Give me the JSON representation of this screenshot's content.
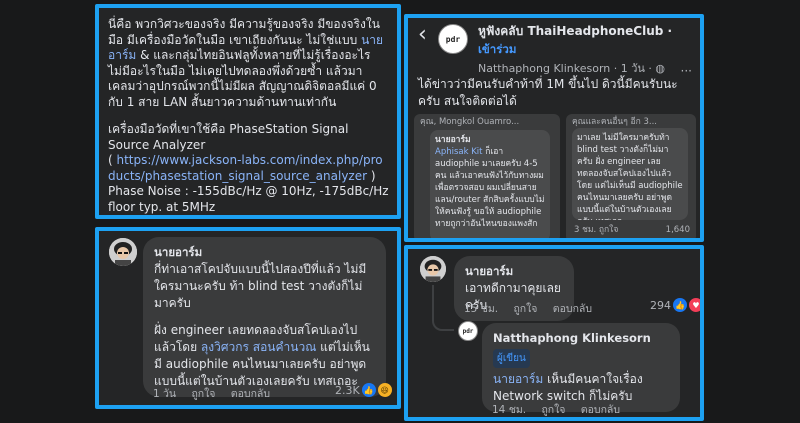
{
  "post_text": {
    "para1_a": "นี่คือ พวกวิศวะของจริง มีความรู้ของจริง มีของจริงในมือ มีเครื่องมือวัดในมือ เขาเถียงกันนะ ไม่ใช่แบบ ",
    "para1_link": "นายอาร์ม",
    "para1_b": " & และกลุ่มไทยอินฟลูทั้งหลายที่ไม่รู้เรื่องอะไร ไม่มีอะไรในมือ ไม่เคยไปทดลองพึ่งด้วยซ้ำ แล้วมาเคลมว่าอุปกรณ์พวกนี้ไม่มีผล สัญญาณดิจิตอลมีแค่ 0 กับ 1 สาย LAN สั้นยาวความด้านทานเท่ากัน",
    "para2_a": "เครื่องมือวัดที่เขาใช้คือ PhaseStation Signal Source Analyzer",
    "para2_b": "( ",
    "para2_link": "https://www.jackson-labs.com/index.php/products/phasestation_signal_source_analyzer",
    "para2_c": " )",
    "para2_d": "Phase Noise : -155dBc/Hz @ 10Hz, -175dBc/Hz floor typ. at 5MHz"
  },
  "comment1": {
    "name": "นายอาร์ม",
    "line1": "กี่ท่าเอาสโคปจับแบบนี้ไปสองปีที่แล้ว ไม่มีใครมานะครับ ท้า blind test วางตังก็ไม่มาครับ",
    "line2_a": "ฝั่ง engineer เลยทดลองจับสโคปเองไปแล้วโดย ",
    "line2_link": "ลุงวิศวกร สอนคำนวณ",
    "line2_b": " แต่ไม่เห็นมี audiophile คนไหนมาเลยครับ อย่าพูดแบบนี้แต่ในบ้านตัวเองเลยครับ เทสเถอะ",
    "time": "1 วัน",
    "like": "ถูกใจ",
    "reply": "ตอบกลับ",
    "count": "2.3K"
  },
  "group_post": {
    "back": "‹",
    "group_name": "หูฟังคลับ ThaiHeadphoneClub ·",
    "join": "เข้าร่วม",
    "author": "Natthaphong Klinkesorn · 1 วัน · ",
    "more": "···",
    "text": "ได้ข่าวว่ามีคนรับคำท้าที่ 1M ขึ้นไป ดิวนี้มีคนรับนะครับ สนใจติดต่อได้",
    "thumb1_header": "คุณ, Mongkol Ouamro...",
    "thumb1_name": "นายอาร์ม",
    "thumb1_link": "Aphisak Kit",
    "thumb1_text": "ก็เอา audiophile มาเลยครับ 4-5 คน แล้วเอาคนฟังไว้กับทางผมเพื่อตรวจสอบ ผมเปลี่ยนสายแลน/router สักสิบครั้งแบบไม่ให้คนฟังรู้ ขอให้ audiophile ทายถูกว่าอันไหนของแพงสัก",
    "thumb2_header": "คุณและคนอื่นๆ อีก 3...",
    "thumb2_text": "มาเลย ไม่มีใครมาครับท้า blind test วางตังก็ไม่มาครับ ฝั่ง engineer เลยทดลองจับสโคปเองไปแล้วโดย แต่ไม่เห็นมี audiophile คนไหนมาเลยครับ อย่าพูดแบบนี้แต่ในบ้านตัวเองเลยครับ เทสเถอะ",
    "thumb2_meta": "3 ชม.   ถูกใจ",
    "thumb2_count": "1,640"
  },
  "comment2": {
    "name": "นายอาร์ม",
    "text": "เอาทดีกามาคุยเลยครับ",
    "time": "15 ชม.",
    "like": "ถูกใจ",
    "reply": "ตอบกลับ",
    "count": "294"
  },
  "reply1": {
    "name": "Natthaphong Klinkesorn",
    "badge": "ผู้เขียน",
    "text": "นายอาร์ม เห็นมีคนคาใจเรื่อง Network switch ก็ไม่ครับ",
    "time": "14 ชม.",
    "like": "ถูกใจ",
    "reply": "ตอบกลับ"
  },
  "logo_text": "pdr"
}
